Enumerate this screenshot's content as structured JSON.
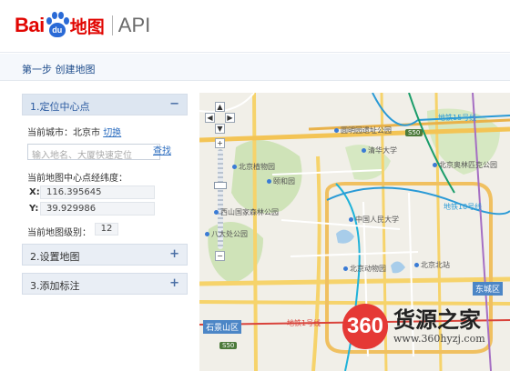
{
  "header": {
    "logo_bai": "Bai",
    "logo_du": "du",
    "logo_ditu": "地图",
    "logo_api": "API",
    "brand_color": "#e10602",
    "paw_color": "#2a6ad6"
  },
  "step": {
    "title": "第一步 创建地图"
  },
  "panel": {
    "section1": {
      "title": "1.定位中心点",
      "toggle": "−"
    },
    "city_label": "当前城市：北京市",
    "switch_link": "切换",
    "search_placeholder": "输入地名、大厦快速定位",
    "search_button": "查找",
    "center_label": "当前地图中心点经纬度：",
    "x_key": "X:",
    "x_value": "116.395645",
    "y_key": "Y:",
    "y_value": "39.929986",
    "zoom_label": "当前地图级别：",
    "zoom_value": "12",
    "section2": {
      "title": "2.设置地图",
      "toggle": "+"
    },
    "section3": {
      "title": "3.添加标注",
      "toggle": "+"
    }
  },
  "map": {
    "pois": [
      "北京植物园",
      "颐和园",
      "清华大学",
      "西山国家森林公园",
      "中国人民大学",
      "北京动物园",
      "北京北站",
      "八大处公园",
      "圆明园遗址公园",
      "北京奥林匹克公园"
    ],
    "road_signs": [
      "S50",
      "S50"
    ],
    "districts": [
      "石景山区",
      "东城区"
    ],
    "metro_labels": [
      "地铁15号线",
      "地铁10号线",
      "地铁1号线"
    ],
    "nav": {
      "up": "▲",
      "left": "◀",
      "right": "▶",
      "down": "▼",
      "plus": "+",
      "minus": "−"
    }
  },
  "watermark": {
    "logo": "360",
    "text": "货源之家",
    "url": "www.360hyzj.com"
  }
}
